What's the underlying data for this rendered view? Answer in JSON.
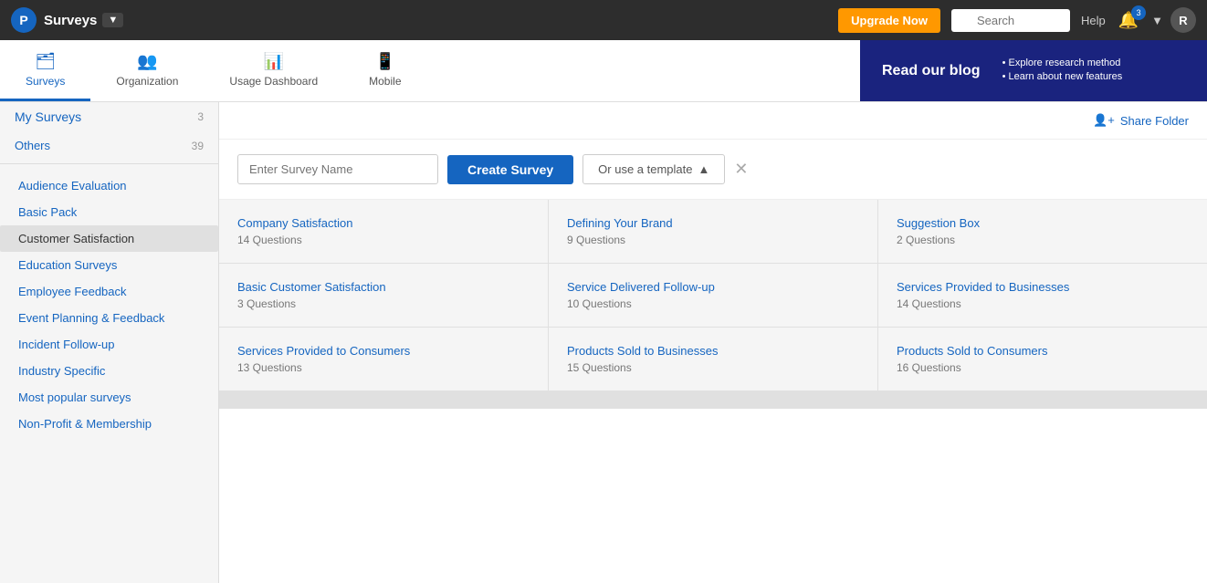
{
  "topNav": {
    "logoLetter": "P",
    "appName": "Surveys",
    "dropdownLabel": "▼",
    "upgradeButton": "Upgrade Now",
    "searchPlaceholder": "Search",
    "helpLabel": "Help",
    "notifCount": "3",
    "userInitial": "R"
  },
  "subNav": {
    "tabs": [
      {
        "id": "surveys",
        "label": "Surveys",
        "icon": "🗂",
        "active": true
      },
      {
        "id": "organization",
        "label": "Organization",
        "icon": "👥",
        "active": false
      },
      {
        "id": "usage-dashboard",
        "label": "Usage Dashboard",
        "icon": "📊",
        "active": false
      },
      {
        "id": "mobile",
        "label": "Mobile",
        "icon": "📱",
        "active": false
      }
    ],
    "blog": {
      "title": "Read our blog",
      "bullets": [
        "Explore research method",
        "Learn about new features"
      ]
    }
  },
  "sidebar": {
    "mySurveysLabel": "My Surveys",
    "mySurveysCount": "3",
    "othersLabel": "Others",
    "othersCount": "39",
    "categories": [
      "Audience Evaluation",
      "Basic Pack",
      "Customer Satisfaction",
      "Education Surveys",
      "Employee Feedback",
      "Event Planning & Feedback",
      "Incident Follow-up",
      "Industry Specific",
      "Most popular surveys",
      "Non-Profit & Membership"
    ],
    "selectedCategory": "Customer Satisfaction"
  },
  "rightPanel": {
    "shareFolderLabel": "Share Folder",
    "surveyNamePlaceholder": "Enter Survey Name",
    "createSurveyLabel": "Create Survey",
    "useTemplateLabel": "Or use a template",
    "templates": [
      {
        "title": "Company Satisfaction",
        "sub": "14 Questions"
      },
      {
        "title": "Defining Your Brand",
        "sub": "9 Questions"
      },
      {
        "title": "Suggestion Box",
        "sub": "2 Questions"
      },
      {
        "title": "Basic Customer Satisfaction",
        "sub": "3 Questions"
      },
      {
        "title": "Service Delivered Follow-up",
        "sub": "10 Questions"
      },
      {
        "title": "Services Provided to Businesses",
        "sub": "14 Questions"
      },
      {
        "title": "Services Provided to Consumers",
        "sub": "13 Questions"
      },
      {
        "title": "Products Sold to Businesses",
        "sub": "15 Questions"
      },
      {
        "title": "Products Sold to Consumers",
        "sub": "16 Questions"
      }
    ]
  }
}
